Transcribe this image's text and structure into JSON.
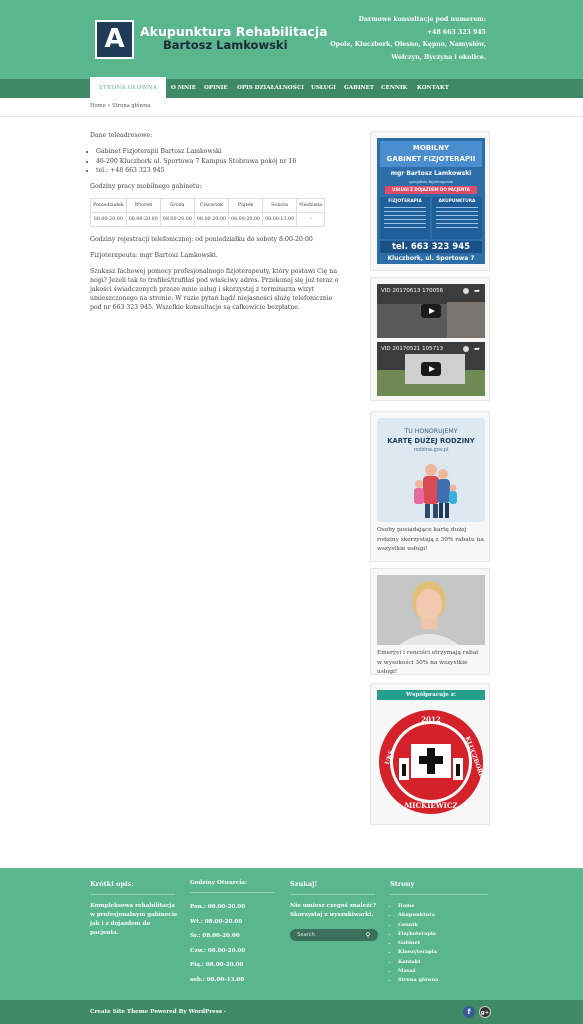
{
  "header": {
    "logo_letter": "A",
    "title": "Akupunktura Rehabilitacja",
    "subtitle": "Bartosz Lamkowski",
    "contact_lines": [
      "Darmowe konsultacje pod numerem:",
      "+48 663 323 945",
      "Opole, Kluczbork, Olesno, Kępno, Namysłów,",
      "Wołczyn, Byczyna i okolice."
    ]
  },
  "nav": {
    "items": [
      "Strona główna",
      "O mnie",
      "Opinie",
      "Opis działalności",
      "Usługi",
      "Gabinet",
      "Cennik",
      "Kontakt"
    ],
    "active": "Strona główna"
  },
  "breadcrumb": "Home » Strona główna",
  "content": {
    "intro": "Dane teleadresowe:",
    "address": [
      "Gabinet Fizjoterapii Bartosz Lamkowski",
      "46-200 Kluczbork ul. Sportowa 7 Kampus Stobrawa pokój nr 16",
      "tel.: +48 663 323 945"
    ],
    "hours_title": "Godziny pracy mobilnego gabinetu:",
    "hours_table": {
      "days": [
        "Poniedziałek",
        "Wtorek",
        "Środa",
        "Czwartek",
        "Piątek",
        "Sobota",
        "Niedziela"
      ],
      "hours": [
        "08.00-20.00",
        "08.00-20.00",
        "08.00-20.00",
        "08.00-20.00",
        "08.00-20.00",
        "08.00-13.00",
        "-"
      ]
    },
    "registration": "Godziny rejestracji telefonicznej: od poniedziałku do soboty 8:00-20:00",
    "therapist": "Fizjoterapeuta: mgr Bartosz Lamkowski.",
    "pitch": "Szukasz fachowej pomocy profesjonalnego fizjoterapeuty, który postawi Cię na nogi? Jeżeli tak to trafiłeś/trafiłaś pod właściwy adres. Przekonaj się już teraz o jakości świadczonych przeze mnie usług i skorzystaj z terminarza wizyt umieszczonego na stronie. W razie pytań bądź niejasności służę telefonicznie pod nr 663 323 945. Wszelkie konsultacje są całkowicie bezpłatne."
  },
  "sidebar": {
    "poster": {
      "title_1": "MOBILNY",
      "title_2": "GABINET FIZJOTERAPII",
      "name": "mgr Bartosz Lamkowski",
      "specialist": "specjalista fizjoterapeuta",
      "service": "USŁUGI Z DOJAZDEM DO PACJENTA",
      "col_left": "FIZJOTERAPIA",
      "col_right": "AKUPUNKTURA",
      "phone": "tel. 663 323 945",
      "address": "Kluczbork, ul. Sportowa 7"
    },
    "videos": [
      {
        "title": "VID 20170613 170056"
      },
      {
        "title": "VID 20170521 105713"
      }
    ],
    "kdr": {
      "line1": "TU HONORUJEMY",
      "line2": "KARTĘ DUŻEJ RODZINY",
      "line3": "rodzina.gov.pl",
      "caption": "Osoby posiadające kartę dużej rodziny skorzystają z 30% rabatu na wszystkie usługi!"
    },
    "senior": {
      "caption": "Emeryci i renciści otrzymają rabat w wysokości 30% na wszystkie usługi!"
    },
    "cooperation": {
      "title": "Współpracuje z:",
      "logo_year": "2012",
      "logo_text_left": "UKS",
      "logo_text_mid": "MICKIEWICZ",
      "logo_text_right": "KLUCZBORK"
    }
  },
  "footer": {
    "about": {
      "heading": "Krótki opis:",
      "text": "Kompleksowa rehabilitacja w profesjonalnym gabinecie jak i z dojazdem do pacjenta."
    },
    "hours": {
      "heading": "Godziny Otwarcia:",
      "rows": [
        "Pon.: 08.00-20.00",
        "Wt.: 08.00-20.00",
        "Śr.: 08.00-20.00",
        "Czw.: 08.00-20.00",
        "Pią.: 08.00-20.00",
        "sob.: 08.00-13.00"
      ]
    },
    "search": {
      "heading": "Szukaj!",
      "text": "Nie umiesz czegoś znaleźć? Skorzystaj z wyszukiwarki.",
      "placeholder": "Search"
    },
    "pages": {
      "heading": "Strony",
      "items": [
        "Home",
        "Akupunktura",
        "Cennik",
        "Fizykoterapia",
        "Gabinet",
        "Kinezyterapia",
        "Kontakt",
        "Masaż",
        "Strona główna"
      ]
    }
  },
  "bottom": {
    "credit": "Create Site Theme Powered By WordPress -",
    "social": [
      "f",
      "g+"
    ]
  },
  "colors": {
    "header_green": "#59b68d",
    "nav_green": "#3f8a66",
    "logo_navy": "#1f3b58",
    "facebook": "#3b5998",
    "gplus": "#333333"
  }
}
